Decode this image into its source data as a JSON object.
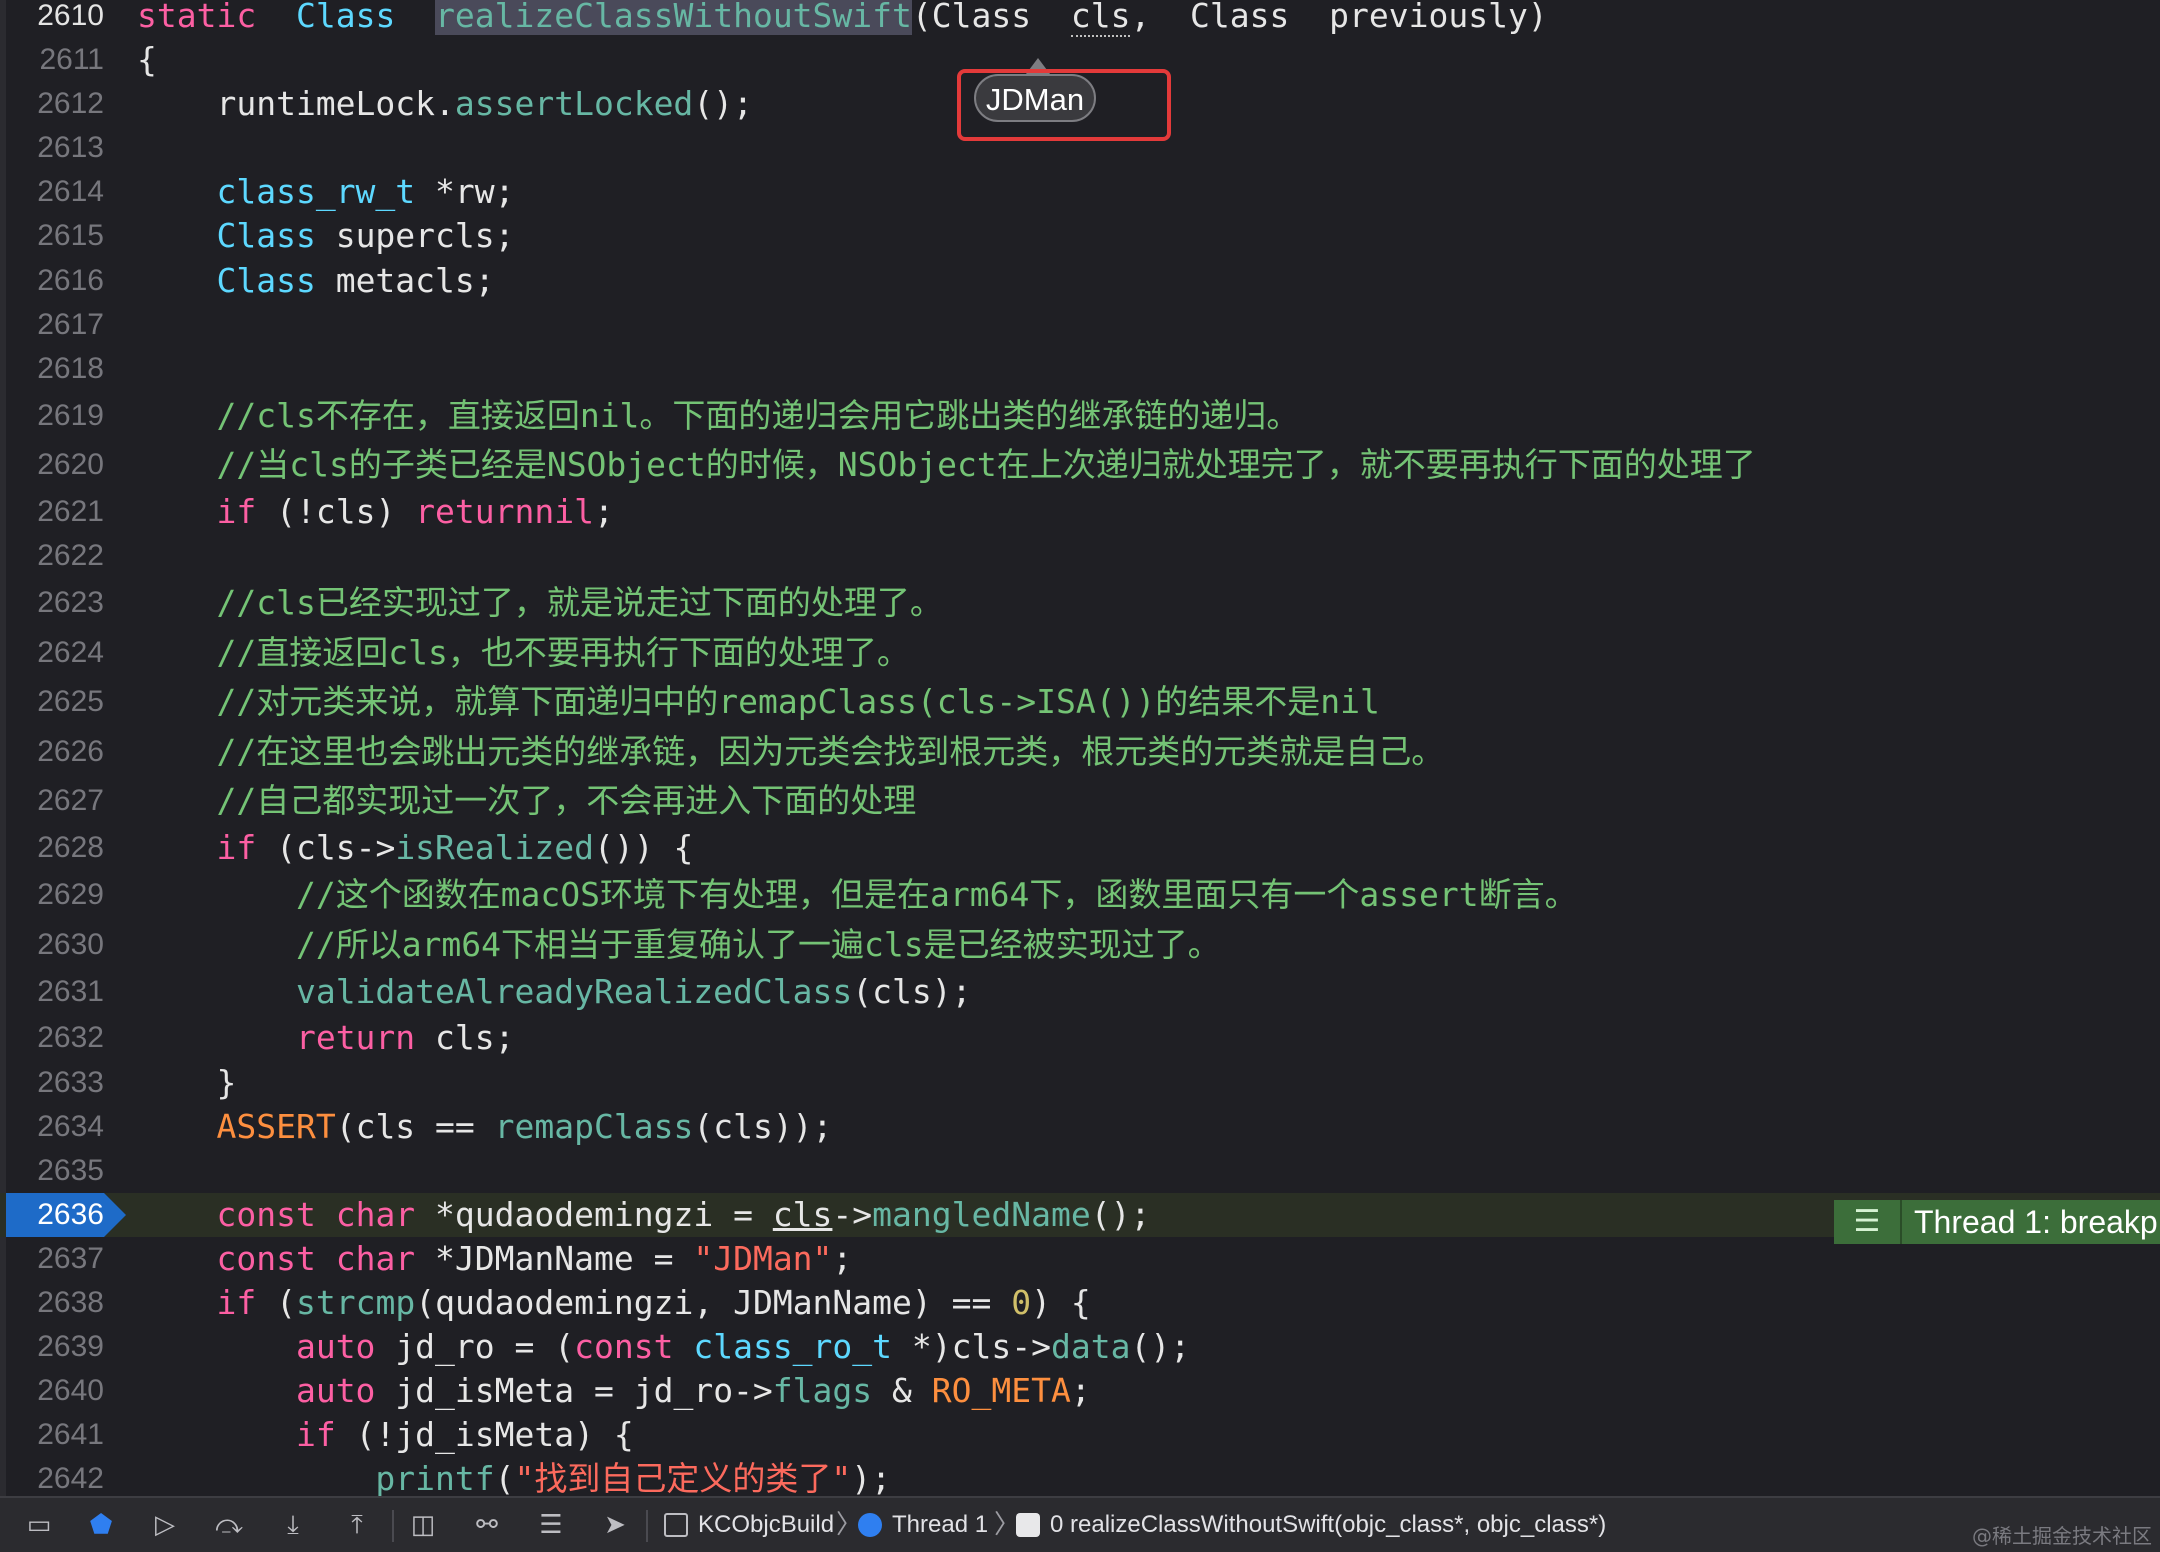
{
  "tooltip": {
    "text": "JDMan"
  },
  "breakpoint_banner": {
    "text": "Thread 1: breakp"
  },
  "watermark": "@稀土掘金技术社区",
  "debug_bar": {
    "breadcrumbs": [
      {
        "label": "KCObjcBuild",
        "icon": "window-icon"
      },
      {
        "label": "Thread 1",
        "icon": "thread-icon"
      },
      {
        "label": "0 realizeClassWithoutSwift(objc_class*, objc_class*)",
        "icon": "gear-icon"
      }
    ],
    "buttons": [
      {
        "name": "hide-debug-area-button",
        "glyph": "▭"
      },
      {
        "name": "breakpoints-toggle-button",
        "glyph": "⬟"
      },
      {
        "name": "continue-button",
        "glyph": "▷"
      },
      {
        "name": "step-over-button",
        "glyph": "⤼"
      },
      {
        "name": "step-into-button",
        "glyph": "⤓"
      },
      {
        "name": "step-out-button",
        "glyph": "⤒"
      },
      {
        "name": "view-hierarchy-button",
        "glyph": "◫"
      },
      {
        "name": "memory-graph-button",
        "glyph": "⚯"
      },
      {
        "name": "environment-overrides-button",
        "glyph": "☰"
      },
      {
        "name": "simulate-location-button",
        "glyph": "➤"
      }
    ]
  },
  "colors": {
    "background": "#1f1f24",
    "keyword": "#fc5fa3",
    "comment": "#74c375",
    "function": "#67b7a4",
    "type": "#5dd8ff",
    "string": "#fc6a5d",
    "macro": "#fd8f3f",
    "breakpoint": "#1e6bc8",
    "annotation_box": "#e33a3a"
  },
  "lines": [
    {
      "n": "2610",
      "tokens": [
        [
          "kw",
          "static"
        ],
        [
          "",
          "  "
        ],
        [
          "ty",
          "Class"
        ],
        [
          "",
          "  "
        ],
        [
          "fn hl-sel",
          "realizeClassWithoutSwift"
        ],
        [
          "",
          "(Class  "
        ],
        [
          "dotted",
          "cls"
        ],
        [
          "",
          ",  Class  previously)"
        ]
      ]
    },
    {
      "n": "2611",
      "tokens": [
        [
          "",
          "{"
        ]
      ]
    },
    {
      "n": "2612",
      "tokens": [
        [
          "",
          "    runtimeLock."
        ],
        [
          "fn",
          "assertLocked"
        ],
        [
          "",
          "();"
        ]
      ]
    },
    {
      "n": "2613",
      "tokens": []
    },
    {
      "n": "2614",
      "tokens": [
        [
          "",
          "    "
        ],
        [
          "ty",
          "class_rw_t"
        ],
        [
          "",
          " *rw;"
        ]
      ]
    },
    {
      "n": "2615",
      "tokens": [
        [
          "",
          "    "
        ],
        [
          "ty",
          "Class"
        ],
        [
          "",
          " supercls;"
        ]
      ]
    },
    {
      "n": "2616",
      "tokens": [
        [
          "",
          "    "
        ],
        [
          "ty",
          "Class"
        ],
        [
          "",
          " metacls;"
        ]
      ]
    },
    {
      "n": "2617",
      "tokens": []
    },
    {
      "n": "2618",
      "tokens": []
    },
    {
      "n": "2619",
      "tokens": [
        [
          "",
          "    "
        ],
        [
          "cm",
          "//cls不存在，直接返回nil。下面的递归会用它跳出类的继承链的递归。"
        ]
      ]
    },
    {
      "n": "2620",
      "tokens": [
        [
          "",
          "    "
        ],
        [
          "cm",
          "//当cls的子类已经是NSObject的时候，NSObject在上次递归就处理完了，就不要再执行下面的处理了"
        ]
      ]
    },
    {
      "n": "2621",
      "tokens": [
        [
          "",
          "    "
        ],
        [
          "kw",
          "if"
        ],
        [
          "",
          " (!cls) "
        ],
        [
          "kw",
          "return"
        ],
        [
          "",
          "",
          " "
        ],
        [
          "kw",
          "nil"
        ],
        [
          "",
          ";"
        ]
      ]
    },
    {
      "n": "2622",
      "tokens": []
    },
    {
      "n": "2623",
      "tokens": [
        [
          "",
          "    "
        ],
        [
          "cm",
          "//cls已经实现过了，就是说走过下面的处理了。"
        ]
      ]
    },
    {
      "n": "2624",
      "tokens": [
        [
          "",
          "    "
        ],
        [
          "cm",
          "//直接返回cls，也不要再执行下面的处理了。"
        ]
      ]
    },
    {
      "n": "2625",
      "tokens": [
        [
          "",
          "    "
        ],
        [
          "cm",
          "//对元类来说，就算下面递归中的remapClass(cls->ISA())的结果不是nil"
        ]
      ]
    },
    {
      "n": "2626",
      "tokens": [
        [
          "",
          "    "
        ],
        [
          "cm",
          "//在这里也会跳出元类的继承链，因为元类会找到根元类，根元类的元类就是自己。"
        ]
      ]
    },
    {
      "n": "2627",
      "tokens": [
        [
          "",
          "    "
        ],
        [
          "cm",
          "//自己都实现过一次了，不会再进入下面的处理"
        ]
      ]
    },
    {
      "n": "2628",
      "tokens": [
        [
          "",
          "    "
        ],
        [
          "kw",
          "if"
        ],
        [
          "",
          " (cls->"
        ],
        [
          "fn",
          "isRealized"
        ],
        [
          "",
          "()) {"
        ]
      ]
    },
    {
      "n": "2629",
      "tokens": [
        [
          "",
          "        "
        ],
        [
          "cm",
          "//这个函数在macOS环境下有处理，但是在arm64下，函数里面只有一个assert断言。"
        ]
      ]
    },
    {
      "n": "2630",
      "tokens": [
        [
          "",
          "        "
        ],
        [
          "cm",
          "//所以arm64下相当于重复确认了一遍cls是已经被实现过了。"
        ]
      ]
    },
    {
      "n": "2631",
      "tokens": [
        [
          "",
          "        "
        ],
        [
          "fn",
          "validateAlreadyRealizedClass"
        ],
        [
          "",
          "(cls);"
        ]
      ]
    },
    {
      "n": "2632",
      "tokens": [
        [
          "",
          "        "
        ],
        [
          "kw",
          "return"
        ],
        [
          "",
          " cls;"
        ]
      ]
    },
    {
      "n": "2633",
      "tokens": [
        [
          "",
          "    }"
        ]
      ]
    },
    {
      "n": "2634",
      "tokens": [
        [
          "",
          "    "
        ],
        [
          "mac",
          "ASSERT"
        ],
        [
          "",
          "(cls == "
        ],
        [
          "fn",
          "remapClass"
        ],
        [
          "",
          "(cls));"
        ]
      ]
    },
    {
      "n": "2635",
      "tokens": []
    },
    {
      "n": "2636",
      "tokens": [
        [
          "",
          "    "
        ],
        [
          "kw",
          "const"
        ],
        [
          "",
          " "
        ],
        [
          "kw",
          "char"
        ],
        [
          "",
          " *qudaodemingzi = "
        ],
        [
          "ul",
          "cls"
        ],
        [
          "",
          "->"
        ],
        [
          "fn",
          "mangledName"
        ],
        [
          "",
          "();"
        ]
      ]
    },
    {
      "n": "2637",
      "tokens": [
        [
          "",
          "    "
        ],
        [
          "kw",
          "const"
        ],
        [
          "",
          " "
        ],
        [
          "kw",
          "char"
        ],
        [
          "",
          " *JDManName = "
        ],
        [
          "str",
          "\"JDMan\""
        ],
        [
          "",
          ";"
        ]
      ]
    },
    {
      "n": "2638",
      "tokens": [
        [
          "",
          "    "
        ],
        [
          "kw",
          "if"
        ],
        [
          "",
          " ("
        ],
        [
          "fn",
          "strcmp"
        ],
        [
          "",
          "(qudaodemingzi, JDManName) == "
        ],
        [
          "num",
          "0"
        ],
        [
          "",
          ") {"
        ]
      ]
    },
    {
      "n": "2639",
      "tokens": [
        [
          "",
          "        "
        ],
        [
          "kw",
          "auto"
        ],
        [
          "",
          " jd_ro = ("
        ],
        [
          "kw",
          "const"
        ],
        [
          "",
          " "
        ],
        [
          "ty",
          "class_ro_t"
        ],
        [
          "",
          " *)cls->"
        ],
        [
          "fn",
          "data"
        ],
        [
          "",
          "();"
        ]
      ]
    },
    {
      "n": "2640",
      "tokens": [
        [
          "",
          "        "
        ],
        [
          "kw",
          "auto"
        ],
        [
          "",
          " jd_isMeta = jd_ro->"
        ],
        [
          "fn",
          "flags"
        ],
        [
          "",
          " & "
        ],
        [
          "mac",
          "RO_META"
        ],
        [
          "",
          ";"
        ]
      ]
    },
    {
      "n": "2641",
      "tokens": [
        [
          "",
          "        "
        ],
        [
          "kw",
          "if"
        ],
        [
          "",
          " (!jd_isMeta) {"
        ]
      ]
    },
    {
      "n": "2642",
      "tokens": [
        [
          "",
          "            "
        ],
        [
          "fn",
          "printf"
        ],
        [
          "",
          "("
        ],
        [
          "str",
          "\"找到自己定义的类了\""
        ],
        [
          "",
          ");"
        ]
      ]
    }
  ],
  "active_line": "2636"
}
